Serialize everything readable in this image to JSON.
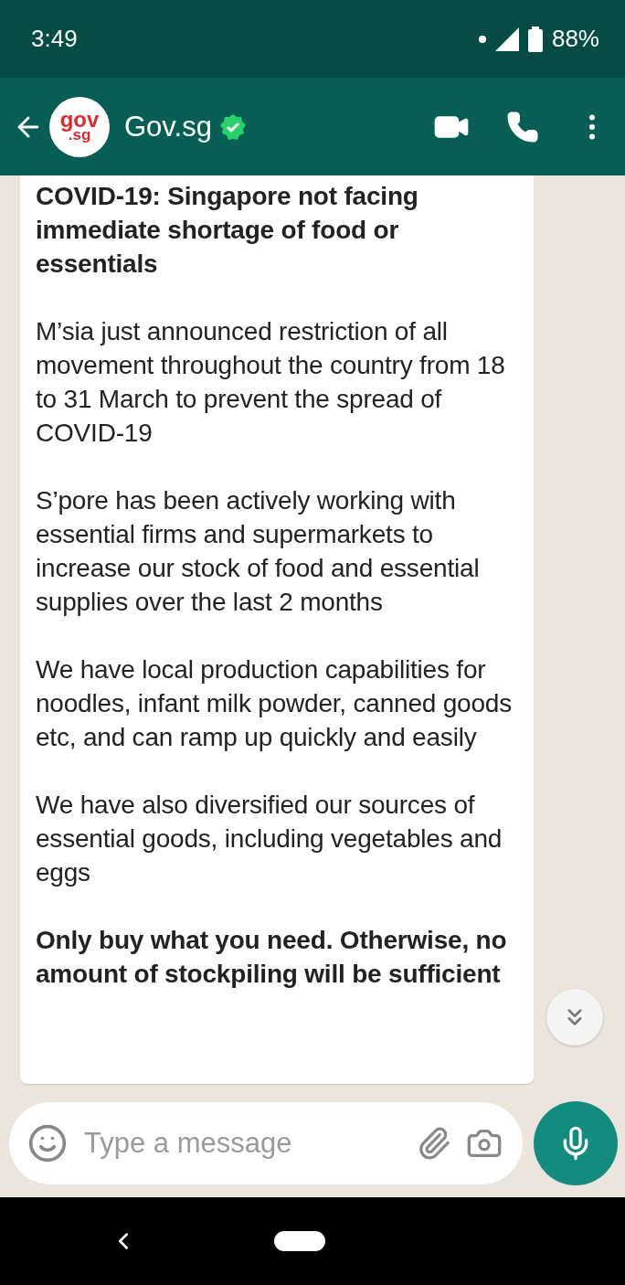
{
  "status_bar": {
    "time": "3:49",
    "battery": "88%"
  },
  "header": {
    "avatar_lines": [
      "gov",
      ".sg"
    ],
    "name": "Gov.sg",
    "verified": true
  },
  "message": {
    "paragraphs": [
      {
        "kind": "bold",
        "text": "COVID-19: Singapore not facing immediate shortage of food or essentials"
      },
      {
        "kind": "normal",
        "text": "M’sia just announced restriction of all movement throughout the country from 18 to 31 March to prevent the spread of COVID-19"
      },
      {
        "kind": "normal",
        "text": "S’pore has been actively working with essential firms and supermarkets to increase our stock of food and essential supplies over the last 2 months"
      },
      {
        "kind": "normal",
        "text": "We have local production capabilities for noodles, infant milk powder, canned goods etc, and can ramp up quickly and easily"
      },
      {
        "kind": "normal",
        "text": "We have also diversified our sources of essential goods, including vegetables and eggs"
      },
      {
        "kind": "bold",
        "text": "Only buy what you need. Otherwise, no amount of stockpiling will be sufficient"
      }
    ]
  },
  "composer": {
    "placeholder": "Type a message"
  }
}
